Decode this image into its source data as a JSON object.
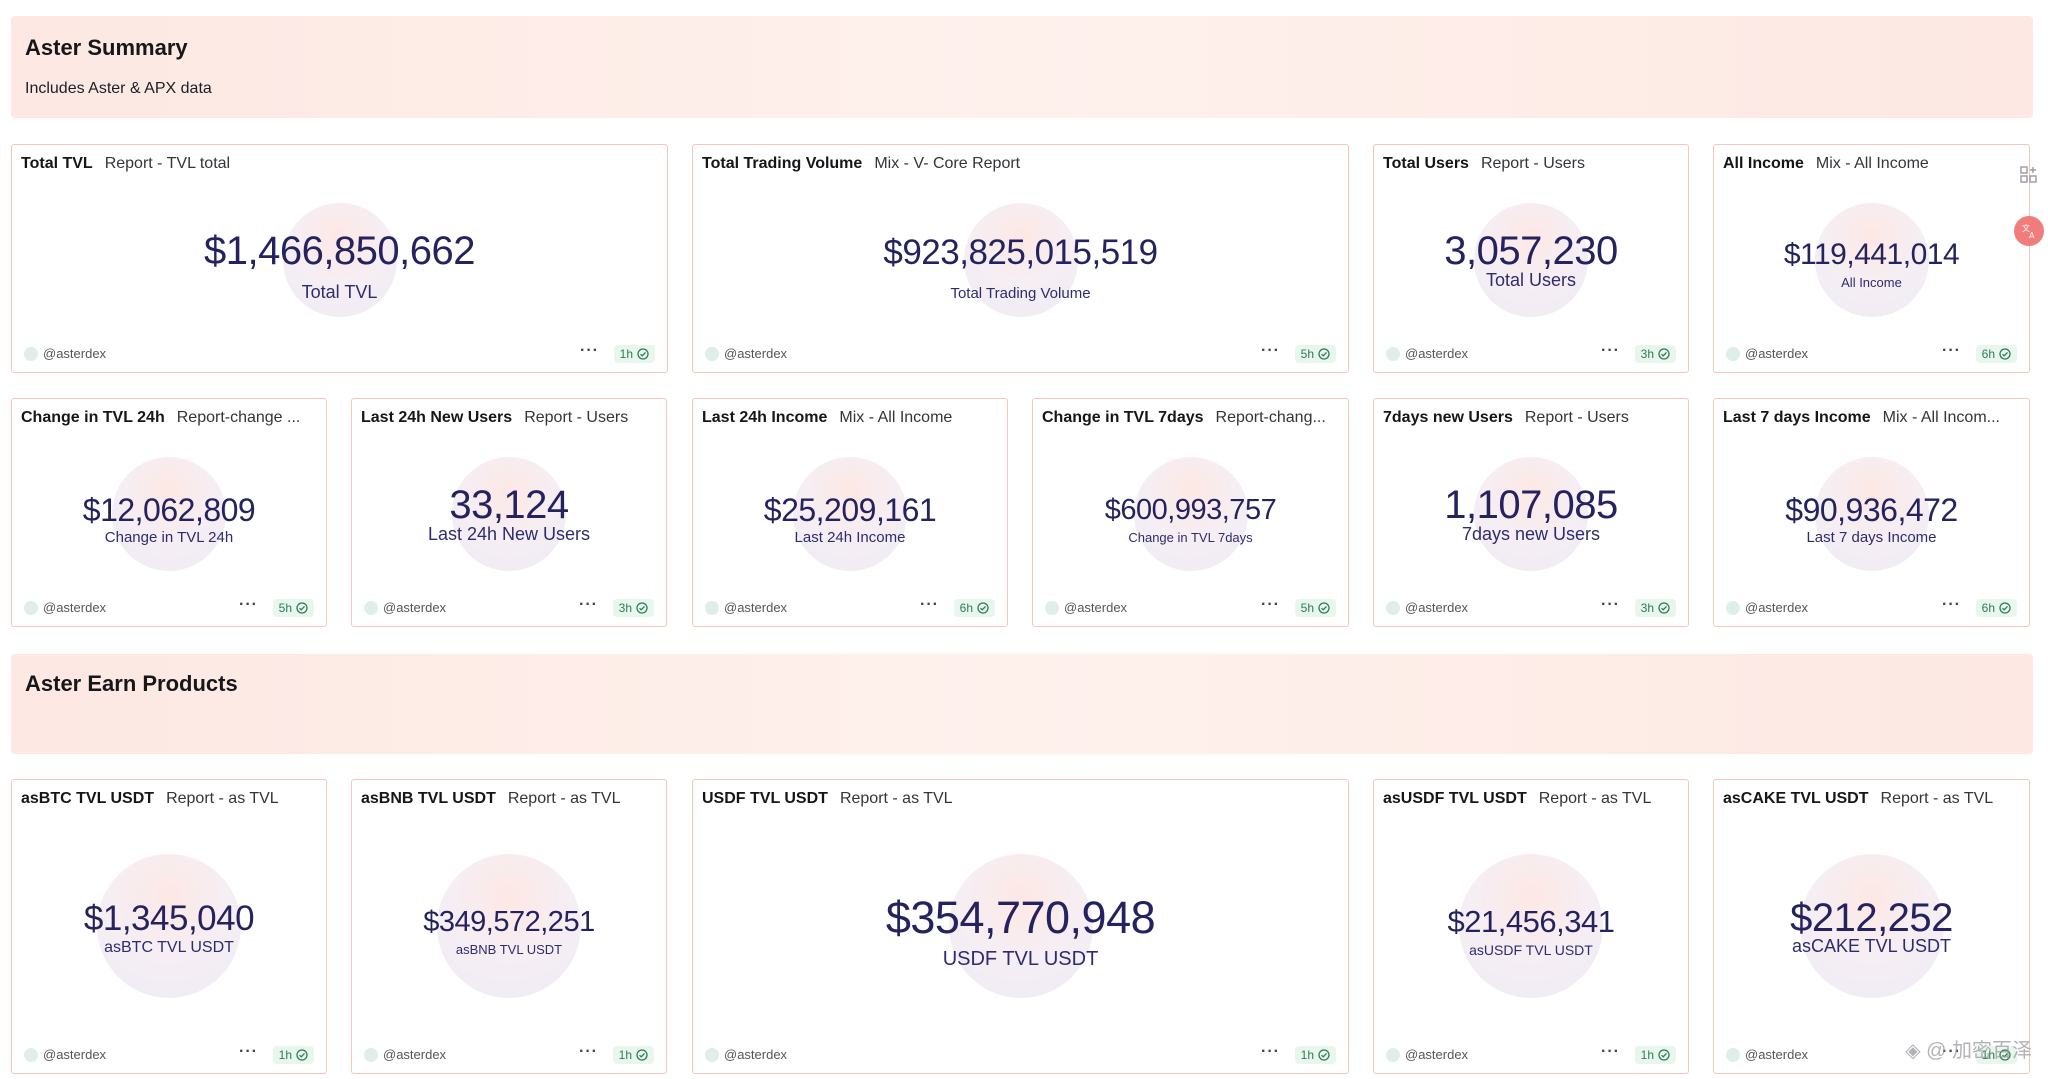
{
  "sections": {
    "summary": {
      "title": "Aster Summary",
      "subtitle": "Includes Aster & APX data"
    },
    "earn": {
      "title": "Aster Earn Products"
    }
  },
  "cards": [
    {
      "title": "Total TVL",
      "query": "Report - TVL total",
      "value": "$1,466,850,662",
      "label": "Total TVL",
      "author": "@asterdex",
      "age": "1h"
    },
    {
      "title": "Total Trading Volume",
      "query": "Mix - V- Core Report",
      "value": "$923,825,015,519",
      "label": "Total Trading Volume",
      "author": "@asterdex",
      "age": "5h"
    },
    {
      "title": "Total Users",
      "query": "Report - Users",
      "value": "3,057,230",
      "label": "Total Users",
      "author": "@asterdex",
      "age": "3h"
    },
    {
      "title": "All Income",
      "query": "Mix - All Income",
      "value": "$119,441,014",
      "label": "All Income",
      "author": "@asterdex",
      "age": "6h"
    },
    {
      "title": "Change in TVL 24h",
      "query": "Report-change ...",
      "value": "$12,062,809",
      "label": "Change in TVL 24h",
      "author": "@asterdex",
      "age": "5h"
    },
    {
      "title": "Last 24h New Users",
      "query": "Report - Users",
      "value": "33,124",
      "label": "Last 24h New Users",
      "author": "@asterdex",
      "age": "3h"
    },
    {
      "title": "Last 24h Income",
      "query": "Mix - All Income",
      "value": "$25,209,161",
      "label": "Last 24h Income",
      "author": "@asterdex",
      "age": "6h"
    },
    {
      "title": "Change in TVL 7days",
      "query": "Report-chang...",
      "value": "$600,993,757",
      "label": "Change in TVL 7days",
      "author": "@asterdex",
      "age": "5h"
    },
    {
      "title": "7days new Users",
      "query": "Report - Users",
      "value": "1,107,085",
      "label": "7days new Users",
      "author": "@asterdex",
      "age": "3h"
    },
    {
      "title": "Last 7 days Income",
      "query": "Mix - All Incom...",
      "value": "$90,936,472",
      "label": "Last 7 days Income",
      "author": "@asterdex",
      "age": "6h"
    },
    {
      "title": "asBTC TVL USDT",
      "query": "Report - as TVL",
      "value": "$1,345,040",
      "label": "asBTC TVL USDT",
      "author": "@asterdex",
      "age": "1h"
    },
    {
      "title": "asBNB TVL USDT",
      "query": "Report - as TVL",
      "value": "$349,572,251",
      "label": "asBNB TVL USDT",
      "author": "@asterdex",
      "age": "1h"
    },
    {
      "title": "USDF TVL USDT",
      "query": "Report - as TVL",
      "value": "$354,770,948",
      "label": "USDF TVL USDT",
      "author": "@asterdex",
      "age": "1h"
    },
    {
      "title": "asUSDF TVL USDT",
      "query": "Report - as TVL",
      "value": "$21,456,341",
      "label": "asUSDF TVL USDT",
      "author": "@asterdex",
      "age": "1h"
    },
    {
      "title": "asCAKE TVL USDT",
      "query": "Report - as TVL",
      "value": "$212,252",
      "label": "asCAKE TVL USDT",
      "author": "@asterdex",
      "age": "1h"
    }
  ],
  "more_glyph": "···",
  "watermark": "◈ @ 加密百泽",
  "icons": {
    "expand": "grid-plus-icon",
    "translate": "translate-icon",
    "status": "check-circle-icon"
  }
}
